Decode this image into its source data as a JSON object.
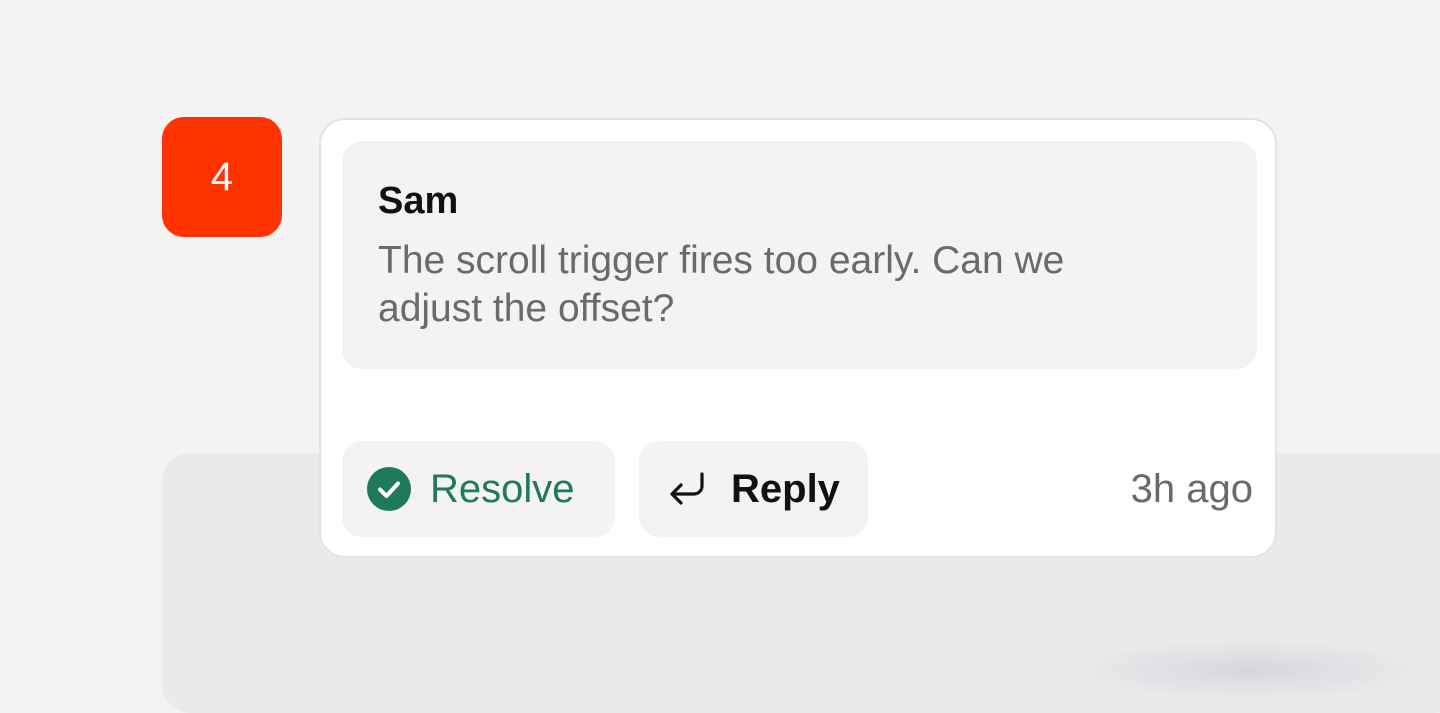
{
  "thread": {
    "number": "4",
    "author": "Sam",
    "message": "The scroll trigger fires too early. Can we adjust the offset?",
    "timestamp": "3h ago"
  },
  "actions": {
    "resolve_label": "Resolve",
    "resolve_icon": "check-circle-icon",
    "reply_label": "Reply",
    "reply_icon": "reply-arrow-icon"
  },
  "colors": {
    "badge": "#ff3300",
    "resolve": "#1f7a5c",
    "muted_text": "#6a6a6a",
    "bubble": "#f4f3f2"
  }
}
